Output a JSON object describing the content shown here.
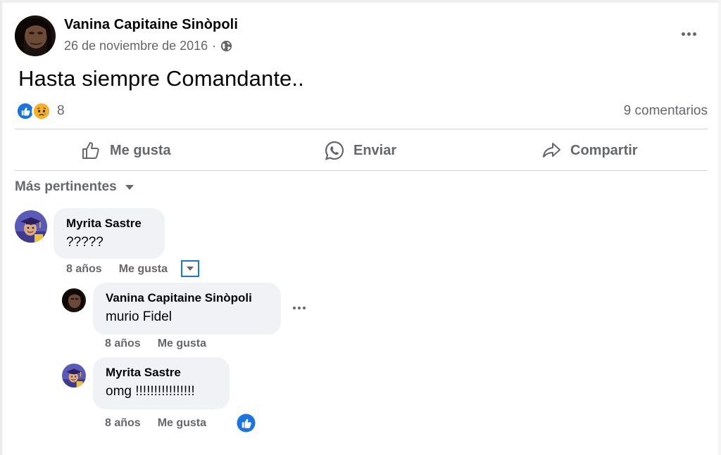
{
  "post": {
    "author": "Vanina Capitaine Sinòpoli",
    "date": "26 de noviembre de 2016",
    "date_separator": "·",
    "privacy_icon": "globe-icon",
    "more_icon": "more-horizontal-icon",
    "text": "Hasta siempre Comandante..",
    "reactions": {
      "icons": [
        "like-reaction-icon",
        "sad-reaction-icon"
      ],
      "count": "8"
    },
    "comments_count": "9 comentarios"
  },
  "actions": {
    "like": "Me gusta",
    "send": "Enviar",
    "share": "Compartir"
  },
  "sort": {
    "label": "Más pertinentes"
  },
  "comments": [
    {
      "author": "Myrita Sastre",
      "text": "?????",
      "time": "8 años",
      "like_label": "Me gusta"
    }
  ],
  "replies": [
    {
      "author": "Vanina Capitaine Sinòpoli",
      "text": "murio Fidel",
      "time": "8 años",
      "like_label": "Me gusta"
    },
    {
      "author": "Myrita Sastre",
      "text": "omg !!!!!!!!!!!!!!!!",
      "time": "8 años",
      "like_label": "Me gusta",
      "reaction": "like-reaction-icon"
    }
  ],
  "colors": {
    "accent": "#1b74e4",
    "secondary_text": "#65676b",
    "bubble": "#f0f2f5",
    "divider": "#ced0d4",
    "sad_yellow": "#f7b125"
  }
}
